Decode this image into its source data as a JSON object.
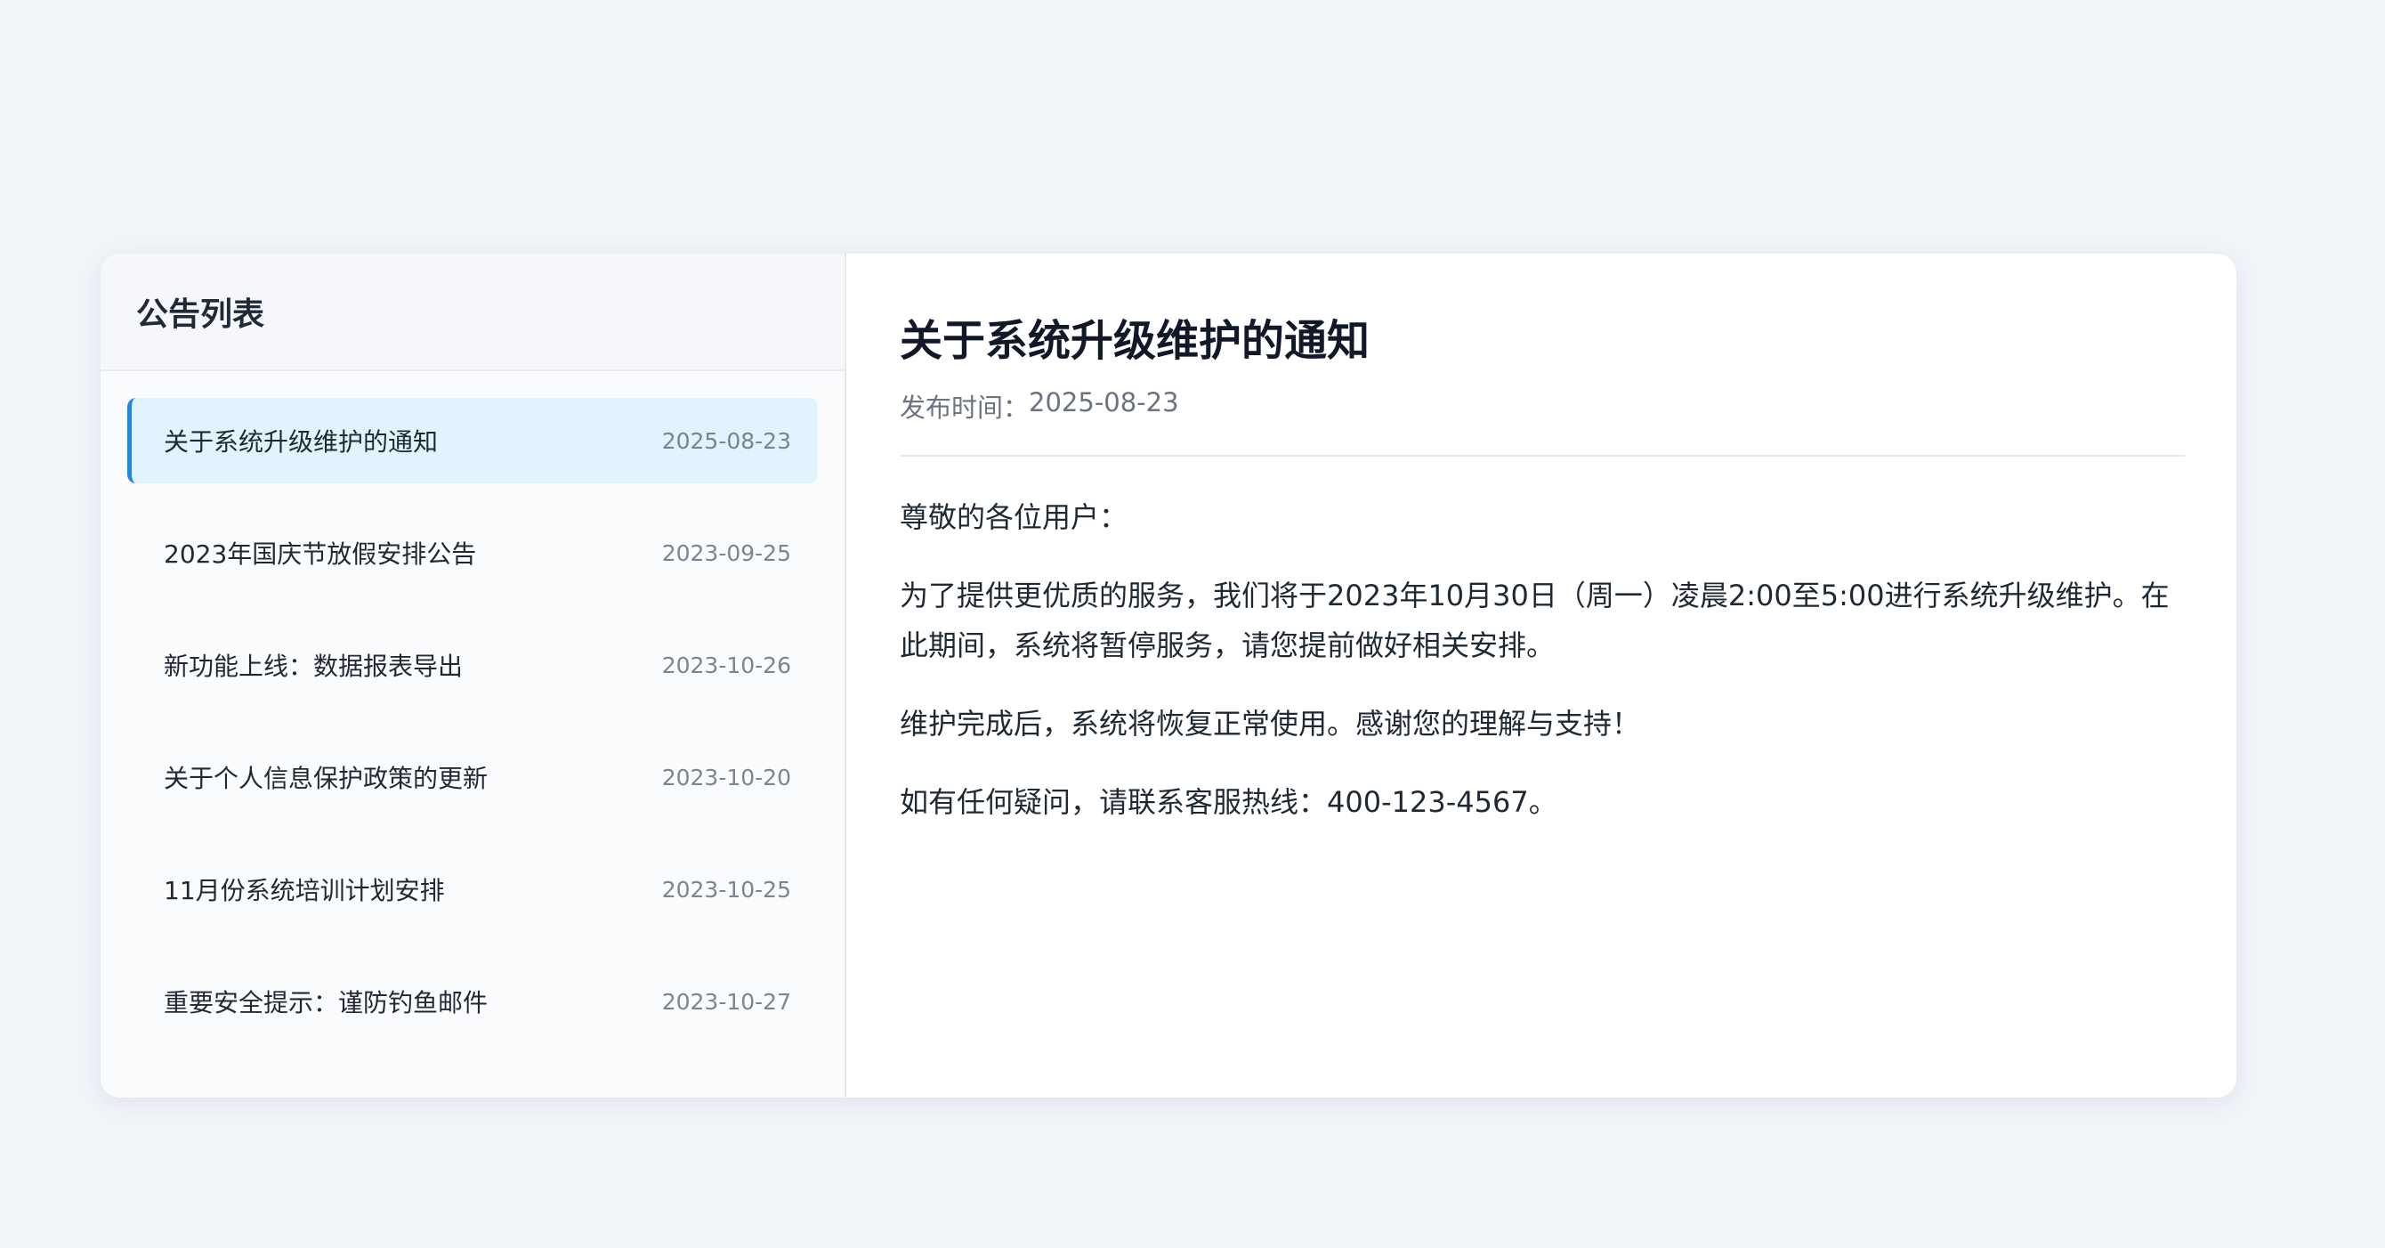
{
  "sidebar": {
    "title": "公告列表",
    "items": [
      {
        "title": "关于系统升级维护的通知",
        "date": "2025-08-23",
        "active": true
      },
      {
        "title": "2023年国庆节放假安排公告",
        "date": "2023-09-25",
        "active": false
      },
      {
        "title": "新功能上线：数据报表导出",
        "date": "2023-10-26",
        "active": false
      },
      {
        "title": "关于个人信息保护政策的更新",
        "date": "2023-10-20",
        "active": false
      },
      {
        "title": "11月份系统培训计划安排",
        "date": "2023-10-25",
        "active": false
      },
      {
        "title": "重要安全提示：谨防钓鱼邮件",
        "date": "2023-10-27",
        "active": false
      }
    ]
  },
  "detail": {
    "title": "关于系统升级维护的通知",
    "publish_label": "发布时间：",
    "publish_date": "2025-08-23",
    "paragraphs": [
      "尊敬的各位用户：",
      "为了提供更优质的服务，我们将于2023年10月30日（周一）凌晨2:00至5:00进行系统升级维护。在此期间，系统将暂停服务，请您提前做好相关安排。",
      "维护完成后，系统将恢复正常使用。感谢您的理解与支持！",
      "如有任何疑问，请联系客服热线：400-123-4567。"
    ]
  },
  "colors": {
    "background": "#f1f4f9",
    "accent": "#1e88e5",
    "active_item_bg": "#e1f3fc"
  }
}
